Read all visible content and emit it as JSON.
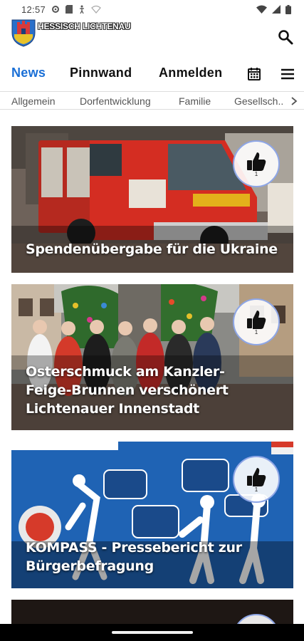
{
  "status": {
    "time": "12:57"
  },
  "header": {
    "brand": "HESSISCH LICHTENAU"
  },
  "tabs": [
    {
      "label": "News"
    },
    {
      "label": "Pinnwand"
    },
    {
      "label": "Anmelden"
    }
  ],
  "categories": [
    "Allgemein",
    "Dorfentwicklung",
    "Familie",
    "Gesellsch..."
  ],
  "articles": [
    {
      "title": "Spendenübergabe für die Ukraine",
      "likes": "1"
    },
    {
      "title": "Osterschmuck am Kanzler-Feige-Brunnen verschönert Lichtenauer Innenstadt",
      "likes": "1"
    },
    {
      "title": "KOMPASS - Pressebericht zur Bürgerbefragung",
      "likes": "1"
    }
  ],
  "colors": {
    "accent": "#1a6fd6",
    "like_ring": "#8ea6e6"
  }
}
